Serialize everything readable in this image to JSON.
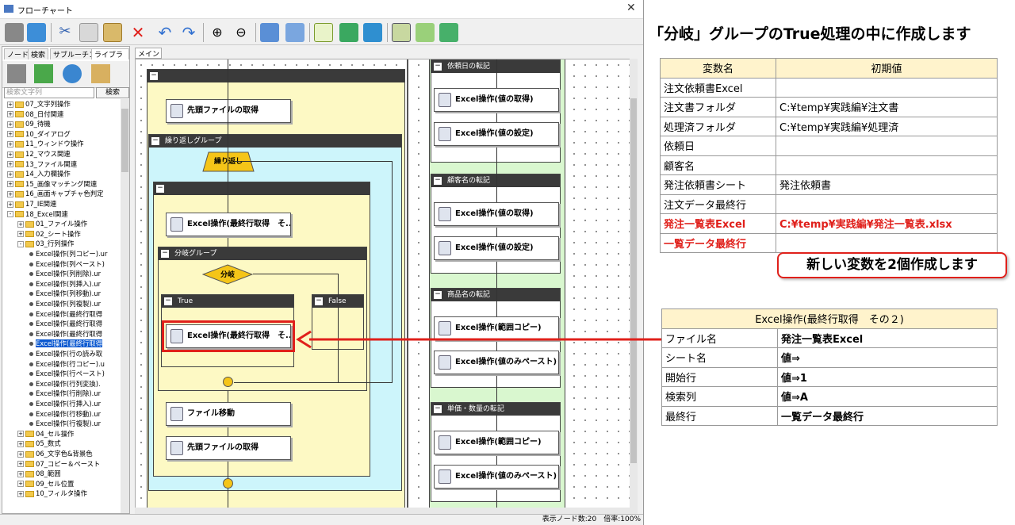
{
  "window": {
    "title": "フローチャート",
    "close": "✕"
  },
  "left_tabs": [
    "ノード",
    "検索",
    "サブルーチン",
    "ライブラリ"
  ],
  "search": {
    "placeholder": "検索文字列",
    "button": "検索"
  },
  "tree": [
    {
      "depth": 0,
      "pm": "+",
      "kind": "folder",
      "label": "07_文字列操作"
    },
    {
      "depth": 0,
      "pm": "+",
      "kind": "folder",
      "label": "08_日付関連"
    },
    {
      "depth": 0,
      "pm": "+",
      "kind": "folder",
      "label": "09_待機"
    },
    {
      "depth": 0,
      "pm": "+",
      "kind": "folder",
      "label": "10_ダイアログ"
    },
    {
      "depth": 0,
      "pm": "+",
      "kind": "folder",
      "label": "11_ウィンドウ操作"
    },
    {
      "depth": 0,
      "pm": "+",
      "kind": "folder",
      "label": "12_マウス関連"
    },
    {
      "depth": 0,
      "pm": "+",
      "kind": "folder",
      "label": "13_ファイル関連"
    },
    {
      "depth": 0,
      "pm": "+",
      "kind": "folder",
      "label": "14_入力欄操作"
    },
    {
      "depth": 0,
      "pm": "+",
      "kind": "folder",
      "label": "15_画像マッチング関連"
    },
    {
      "depth": 0,
      "pm": "+",
      "kind": "folder",
      "label": "16_画面キャプチャ色判定"
    },
    {
      "depth": 0,
      "pm": "+",
      "kind": "folder",
      "label": "17_IE関連"
    },
    {
      "depth": 0,
      "pm": "-",
      "kind": "folder",
      "label": "18_Excel関連"
    },
    {
      "depth": 1,
      "pm": "+",
      "kind": "folder",
      "label": "01_ファイル操作"
    },
    {
      "depth": 1,
      "pm": "+",
      "kind": "folder",
      "label": "02_シート操作"
    },
    {
      "depth": 1,
      "pm": "-",
      "kind": "folder",
      "label": "03_行列操作"
    },
    {
      "depth": 2,
      "pm": "",
      "kind": "item",
      "label": "Excel操作(列コピー).ur"
    },
    {
      "depth": 2,
      "pm": "",
      "kind": "item",
      "label": "Excel操作(列ペースト)"
    },
    {
      "depth": 2,
      "pm": "",
      "kind": "item",
      "label": "Excel操作(列削除).ur"
    },
    {
      "depth": 2,
      "pm": "",
      "kind": "item",
      "label": "Excel操作(列挿入).ur"
    },
    {
      "depth": 2,
      "pm": "",
      "kind": "item",
      "label": "Excel操作(列移動).ur"
    },
    {
      "depth": 2,
      "pm": "",
      "kind": "item",
      "label": "Excel操作(列複製).ur"
    },
    {
      "depth": 2,
      "pm": "",
      "kind": "item",
      "label": "Excel操作(最終行取得"
    },
    {
      "depth": 2,
      "pm": "",
      "kind": "item",
      "label": "Excel操作(最終行取得"
    },
    {
      "depth": 2,
      "pm": "",
      "kind": "item",
      "label": "Excel操作(最終行取得"
    },
    {
      "depth": 2,
      "pm": "",
      "kind": "item",
      "label": "Excel操作(最終行取得",
      "selected": true
    },
    {
      "depth": 2,
      "pm": "",
      "kind": "item",
      "label": "Excel操作(行の読み取"
    },
    {
      "depth": 2,
      "pm": "",
      "kind": "item",
      "label": "Excel操作(行コピー).u"
    },
    {
      "depth": 2,
      "pm": "",
      "kind": "item",
      "label": "Excel操作(行ペースト)"
    },
    {
      "depth": 2,
      "pm": "",
      "kind": "item",
      "label": "Excel操作(行列変換)."
    },
    {
      "depth": 2,
      "pm": "",
      "kind": "item",
      "label": "Excel操作(行削除).ur"
    },
    {
      "depth": 2,
      "pm": "",
      "kind": "item",
      "label": "Excel操作(行挿入).ur"
    },
    {
      "depth": 2,
      "pm": "",
      "kind": "item",
      "label": "Excel操作(行移動).ur"
    },
    {
      "depth": 2,
      "pm": "",
      "kind": "item",
      "label": "Excel操作(行複製).ur"
    },
    {
      "depth": 1,
      "pm": "+",
      "kind": "folder",
      "label": "04_セル操作"
    },
    {
      "depth": 1,
      "pm": "+",
      "kind": "folder",
      "label": "05_数式"
    },
    {
      "depth": 1,
      "pm": "+",
      "kind": "folder",
      "label": "06_文字色&背景色"
    },
    {
      "depth": 1,
      "pm": "+",
      "kind": "folder",
      "label": "07_コピー＆ペースト"
    },
    {
      "depth": 1,
      "pm": "+",
      "kind": "folder",
      "label": "08_範囲"
    },
    {
      "depth": 1,
      "pm": "+",
      "kind": "folder",
      "label": "09_セル位置"
    },
    {
      "depth": 1,
      "pm": "+",
      "kind": "folder",
      "label": "10_フィルタ操作"
    }
  ],
  "canvas": {
    "tab": "メイン",
    "loop_group": "繰り返しグループ",
    "loop_label": "繰り返し",
    "branch_group": "分岐グループ",
    "branch_label": "分岐",
    "true_label": "True",
    "false_label": "False",
    "nodes_left": [
      "先頭ファイルの取得",
      "Excel操作(最終行取得　そ...",
      "Excel操作(最終行取得　そ...",
      "ファイル移動",
      "先頭ファイルの取得"
    ],
    "sections": [
      {
        "title": "依頼日の転記",
        "nodes": [
          "Excel操作(値の取得)",
          "Excel操作(値の設定)"
        ]
      },
      {
        "title": "顧客名の転記",
        "nodes": [
          "Excel操作(値の取得)",
          "Excel操作(値の設定)"
        ]
      },
      {
        "title": "商品名の転記",
        "nodes": [
          "Excel操作(範囲コピー)",
          "Excel操作(値のみペースト)"
        ]
      },
      {
        "title": "単価・数量の転記",
        "nodes": [
          "Excel操作(範囲コピー)",
          "Excel操作(値のみペースト)"
        ]
      }
    ]
  },
  "status": "表示ノード数:20　倍率:100%",
  "heading": "「分岐」グループのTrue処理の中に作成します",
  "vars_table": {
    "headers": [
      "変数名",
      "初期値"
    ],
    "rows": [
      {
        "name": "注文依頼書Excel",
        "value": "",
        "red": false
      },
      {
        "name": "注文書フォルダ",
        "value": "C:¥temp¥実践編¥注文書",
        "red": false
      },
      {
        "name": "処理済フォルダ",
        "value": "C:¥temp¥実践編¥処理済",
        "red": false
      },
      {
        "name": "依頼日",
        "value": "",
        "red": false
      },
      {
        "name": "顧客名",
        "value": "",
        "red": false
      },
      {
        "name": "発注依頼書シート",
        "value": "発注依頼書",
        "red": false
      },
      {
        "name": "注文データ最終行",
        "value": "",
        "red": false
      },
      {
        "name": "発注一覧表Excel",
        "value": "C:¥temp¥実践編¥発注一覧表.xlsx",
        "red": true
      },
      {
        "name": "一覧データ最終行",
        "value": "",
        "red": true
      }
    ]
  },
  "note": "新しい変数を2個作成します",
  "props_table": {
    "title": "Excel操作(最終行取得　その２)",
    "rows": [
      {
        "k": "ファイル名",
        "v": "発注一覧表Excel"
      },
      {
        "k": "シート名",
        "v": "値⇒"
      },
      {
        "k": "開始行",
        "v": "値⇒1"
      },
      {
        "k": "検索列",
        "v": "値⇒A"
      },
      {
        "k": "最終行",
        "v": "一覧データ最終行"
      }
    ]
  },
  "colors": {
    "red": "#e0201b",
    "header": "#fff3cc",
    "loop": "#cdf5fb",
    "yellow": "#fdf9c4",
    "green": "#d9f7cf",
    "diamond": "#f5c518"
  }
}
